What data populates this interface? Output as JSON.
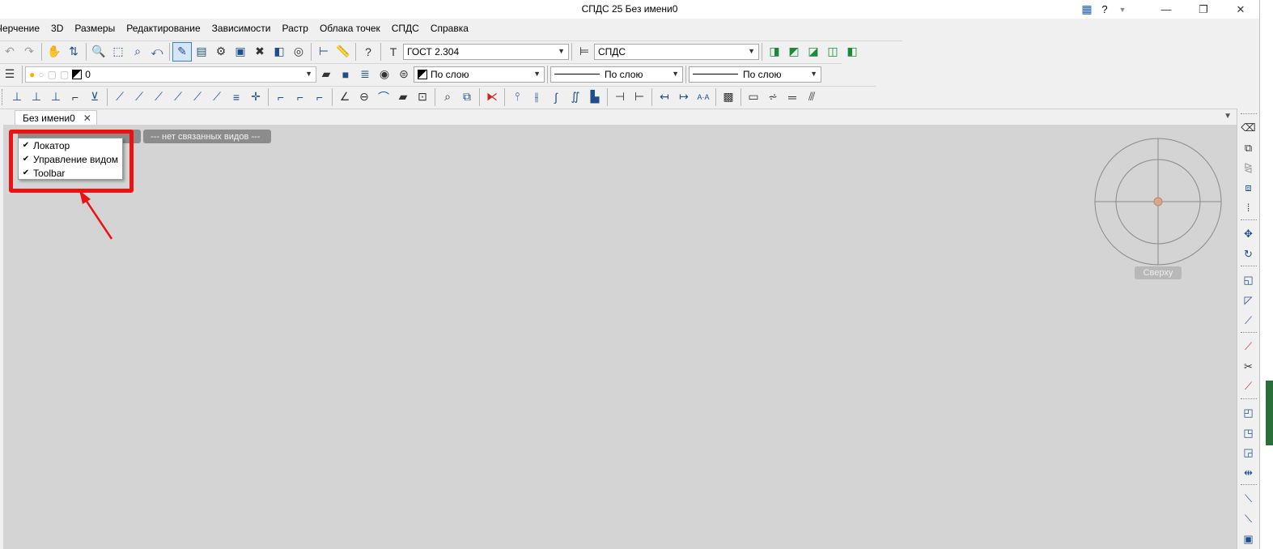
{
  "window": {
    "title": "СПДС 25 Без имени0",
    "help_label": "?",
    "controls": {
      "minimize": "—",
      "maximize": "❐",
      "close": "✕"
    }
  },
  "menu": [
    "Черчение",
    "3D",
    "Размеры",
    "Редактирование",
    "Зависимости",
    "Растр",
    "Облака точек",
    "СПДС",
    "Справка"
  ],
  "toolbar1": {
    "text_style_value": "ГОСТ 2.304",
    "dim_style_value": "СПДС"
  },
  "toolbar2": {
    "layer_value": "0",
    "color_value": "По слою",
    "linetype_value": "По слою",
    "lineweight_value": "По слою"
  },
  "tabs": [
    {
      "label": "Без имени0",
      "close": "✕"
    }
  ],
  "canvas": {
    "linked_views_label": "--- нет связанных видов ---",
    "context_menu": [
      {
        "label": "Локатор",
        "checked": true
      },
      {
        "label": "Управление видом",
        "checked": true
      },
      {
        "label": "Toolbar",
        "checked": true
      }
    ],
    "view_label": "Сверху",
    "highlight_color": "#ee1111",
    "background_color": "#d4d4d4"
  },
  "colors": {
    "accent": "#1e4e8c",
    "active_tool_bg": "#d6e6fa",
    "annotation_red": "#ee1111"
  }
}
